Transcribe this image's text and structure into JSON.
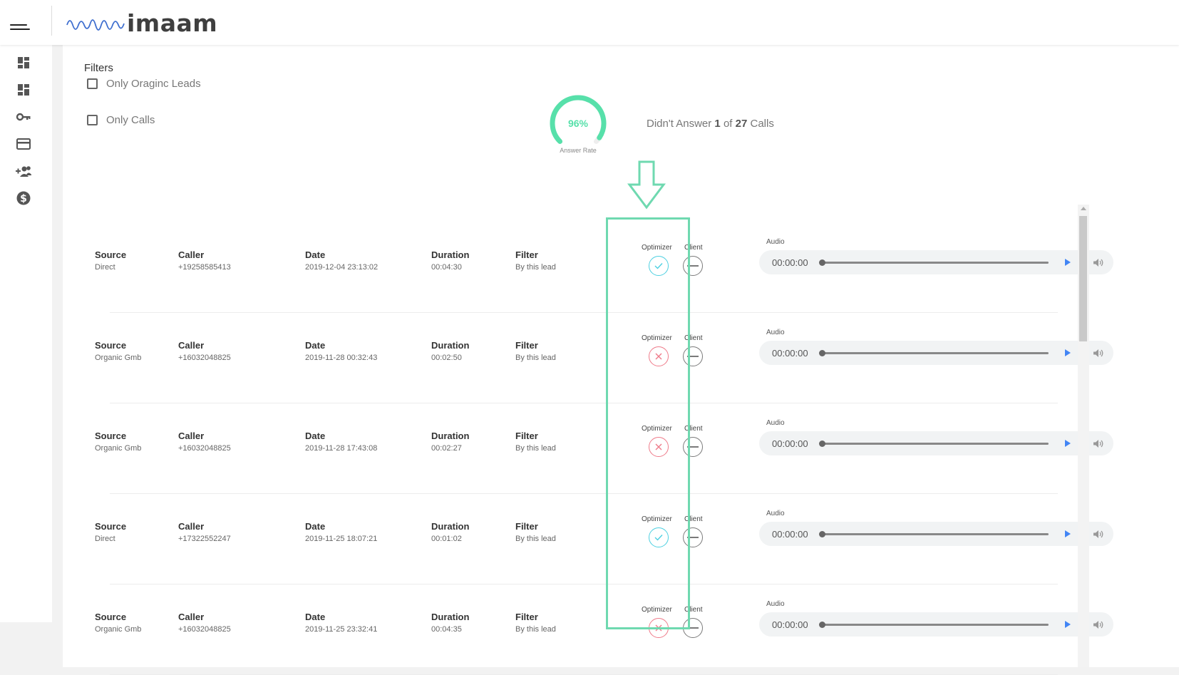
{
  "header": {
    "logo_text": "imaam"
  },
  "sidenav": {
    "items": [
      {
        "icon": "dashboard-icon"
      },
      {
        "icon": "dashboard-icon"
      },
      {
        "icon": "key-icon"
      },
      {
        "icon": "credit-card-icon"
      },
      {
        "icon": "add-user-icon"
      },
      {
        "icon": "dollar-icon"
      }
    ]
  },
  "filters": {
    "title": "Filters",
    "options": [
      {
        "label": "Only Oraginc Leads",
        "checked": false
      },
      {
        "label": "Only Calls",
        "checked": false
      }
    ]
  },
  "answer_rate": {
    "value": "96%",
    "fraction": 0.96,
    "label": "Answer Rate",
    "summary_prefix": "Didn't Answer",
    "missed": "1",
    "summary_of": "of",
    "total": "27",
    "summary_suffix": "Calls"
  },
  "column_labels": {
    "source": "Source",
    "caller": "Caller",
    "date": "Date",
    "duration": "Duration",
    "filter": "Filter",
    "optimizer": "Optimizer",
    "client": "Client",
    "audio": "Audio"
  },
  "calls": [
    {
      "source": "Direct",
      "caller": "+19258585413",
      "date": "2019-12-04 23:13:02",
      "duration": "00:04:30",
      "filter": "By this lead",
      "optimizer": "check",
      "client": "neutral",
      "audio_time": "00:00:00"
    },
    {
      "source": "Organic Gmb",
      "caller": "+16032048825",
      "date": "2019-11-28 00:32:43",
      "duration": "00:02:50",
      "filter": "By this lead",
      "optimizer": "cross",
      "client": "neutral",
      "audio_time": "00:00:00"
    },
    {
      "source": "Organic Gmb",
      "caller": "+16032048825",
      "date": "2019-11-28 17:43:08",
      "duration": "00:02:27",
      "filter": "By this lead",
      "optimizer": "cross",
      "client": "neutral",
      "audio_time": "00:00:00"
    },
    {
      "source": "Direct",
      "caller": "+17322552247",
      "date": "2019-11-25 18:07:21",
      "duration": "00:01:02",
      "filter": "By this lead",
      "optimizer": "check",
      "client": "neutral",
      "audio_time": "00:00:00"
    },
    {
      "source": "Organic Gmb",
      "caller": "+16032048825",
      "date": "2019-11-25 23:32:41",
      "duration": "00:04:35",
      "filter": "By this lead",
      "optimizer": "cross",
      "client": "neutral",
      "audio_time": "00:00:00"
    }
  ],
  "colors": {
    "accent": "#57e0aa",
    "check": "#4dd0e1",
    "cross": "#ef7b8a",
    "player_blue": "#4285f4"
  }
}
